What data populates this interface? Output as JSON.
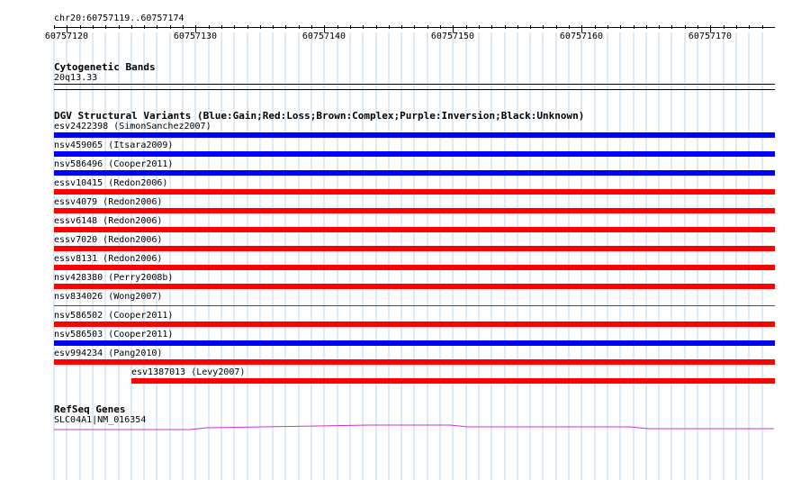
{
  "ruler": {
    "range_label": "chr20:60757119..60757174",
    "start": 60757119,
    "end": 60757174,
    "ticks": [
      "60757120",
      "60757130",
      "60757140",
      "60757150",
      "60757160",
      "60757170"
    ]
  },
  "cytobands": {
    "title": "Cytogenetic Bands",
    "band": "20q13.33"
  },
  "dgv": {
    "title": "DGV Structural Variants (Blue:Gain;Red:Loss;Brown:Complex;Purple:Inversion;Black:Unknown)",
    "colors": {
      "gain": "#0000ff",
      "loss": "#ff0000"
    },
    "variants": [
      {
        "label": "esv2422398 (SimonSanchez2007)",
        "type": "gain"
      },
      {
        "label": "nsv459065 (Itsara2009)",
        "type": "gain"
      },
      {
        "label": "nsv586496 (Cooper2011)",
        "type": "gain"
      },
      {
        "label": "essv10415 (Redon2006)",
        "type": "loss"
      },
      {
        "label": "essv4079 (Redon2006)",
        "type": "loss"
      },
      {
        "label": "essv6148 (Redon2006)",
        "type": "loss"
      },
      {
        "label": "essv7020 (Redon2006)",
        "type": "loss"
      },
      {
        "label": "essv8131 (Redon2006)",
        "type": "loss"
      },
      {
        "label": "nsv428380 (Perry2008b)",
        "type": "loss"
      },
      {
        "label": "nsv834026 (Wong2007)",
        "type": "loss-thin"
      },
      {
        "label": "nsv586502 (Cooper2011)",
        "type": "loss"
      },
      {
        "label": "nsv586503 (Cooper2011)",
        "type": "gain"
      },
      {
        "label": "esv994234 (Pang2010)",
        "type": "loss"
      },
      {
        "label": "esv1387013 (Levy2007)",
        "type": "loss",
        "offset": 6
      }
    ]
  },
  "refseq": {
    "title": "RefSeq Genes",
    "gene": "SLC04A1|NM_016354",
    "color": "#cc33cc"
  }
}
